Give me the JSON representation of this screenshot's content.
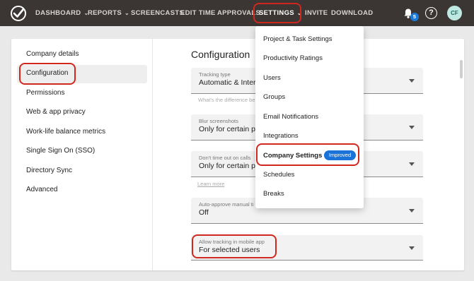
{
  "nav": {
    "items": [
      {
        "label": "DASHBOARD",
        "dropdown": true
      },
      {
        "label": "REPORTS",
        "dropdown": true
      },
      {
        "label": "SCREENCASTS",
        "dropdown": false
      },
      {
        "label": "EDIT TIME",
        "dropdown": false
      },
      {
        "label": "APPROVALS",
        "dropdown": false
      },
      {
        "label": "SETTINGS",
        "dropdown": true,
        "active": true
      },
      {
        "label": "INVITE",
        "dropdown": false
      },
      {
        "label": "DOWNLOAD",
        "dropdown": false
      }
    ],
    "notification_count": "5",
    "help_glyph": "?",
    "avatar_initials": "CF",
    "logo_icon": "check-badge-icon"
  },
  "sidebar": {
    "items": [
      {
        "label": "Company details"
      },
      {
        "label": "Configuration",
        "active": true
      },
      {
        "label": "Permissions"
      },
      {
        "label": "Web & app privacy"
      },
      {
        "label": "Work-life balance metrics"
      },
      {
        "label": "Single Sign On (SSO)"
      },
      {
        "label": "Directory Sync"
      },
      {
        "label": "Advanced"
      }
    ]
  },
  "main": {
    "title": "Configuration",
    "fields": [
      {
        "label": "Tracking type",
        "value": "Automatic & Inter"
      },
      {
        "label": "Blur screenshots",
        "value": "Only for certain p"
      },
      {
        "label": "Don't time out on calls",
        "value": "Only for certain p"
      },
      {
        "label": "Auto-approve manual ti",
        "value": "Off"
      },
      {
        "label": "Allow tracking in mobile app",
        "value": "For selected users"
      }
    ],
    "tracking_helper": "What's the difference be",
    "learn_more": "Learn more"
  },
  "settings_menu": {
    "items": [
      {
        "label": "Project & Task Settings"
      },
      {
        "label": "Productivity Ratings"
      },
      {
        "label": "Users"
      },
      {
        "label": "Groups"
      },
      {
        "label": "Email Notifications"
      },
      {
        "label": "Integrations"
      },
      {
        "label": "Company Settings",
        "badge": "Improved"
      },
      {
        "label": "Schedules"
      },
      {
        "label": "Breaks"
      }
    ]
  },
  "colors": {
    "topbar": "#3b3534",
    "highlight": "#d0281e",
    "accent_blue": "#1a73d9"
  }
}
